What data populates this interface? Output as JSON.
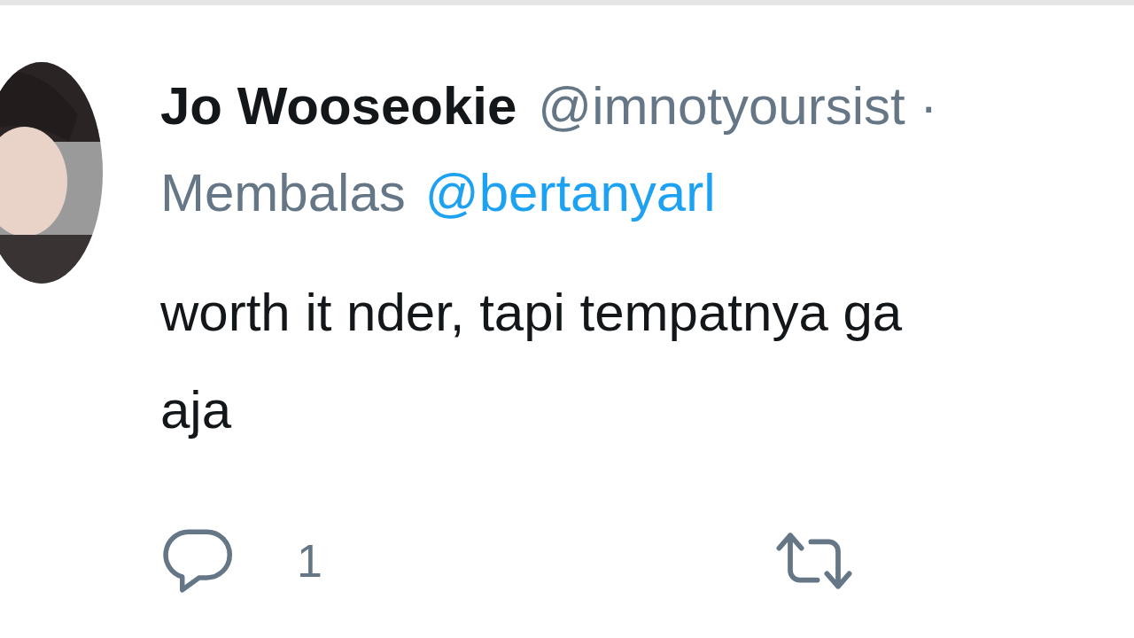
{
  "tweet": {
    "name": "Jo Wooseokie",
    "handle": "@imnotyoursist ·",
    "reply_prefix": "Membalas",
    "reply_to": "@bertanyarl",
    "body_lines": [
      "worth it nder, tapi tempatnya ga",
      "aja"
    ],
    "actions": [
      {
        "kind": "reply",
        "count": "1"
      },
      {
        "kind": "retweet"
      }
    ]
  }
}
